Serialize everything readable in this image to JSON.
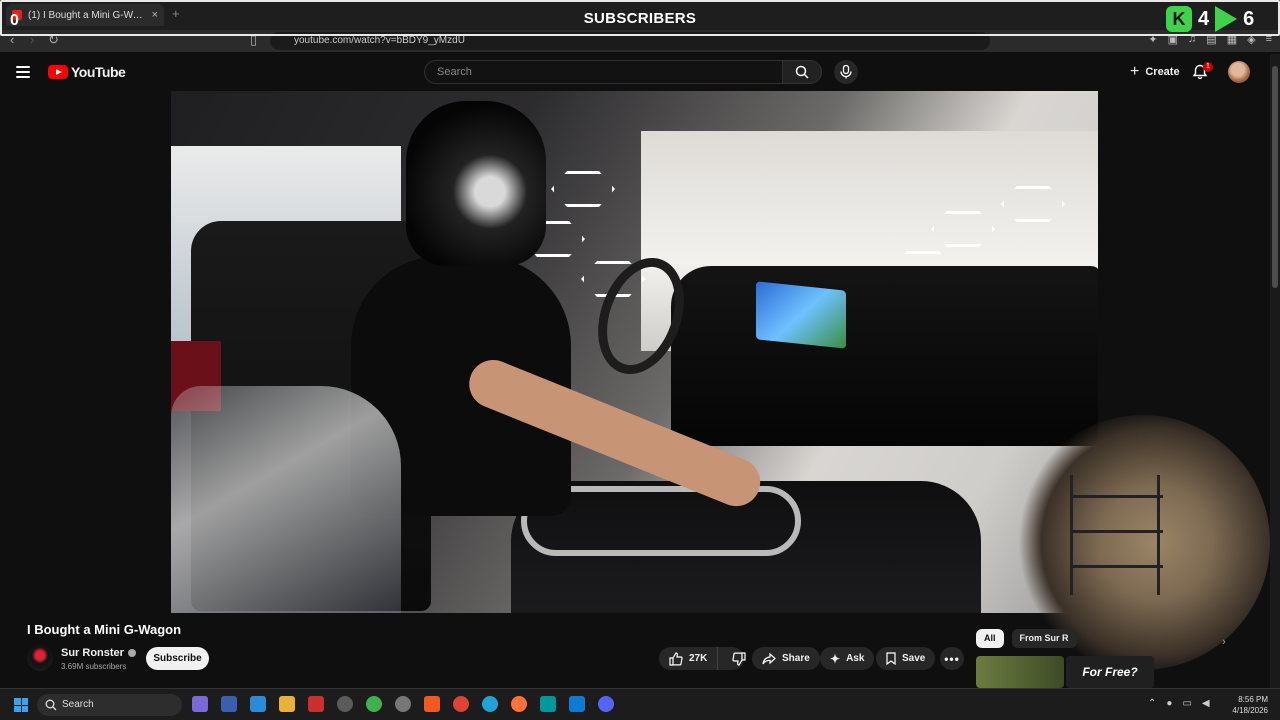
{
  "overlay": {
    "title": "SUBSCRIBERS",
    "left_count": "0",
    "right_count_a": "4",
    "right_count_b": "6"
  },
  "browser": {
    "tab_title": "(1) I Bought a Mini G-Wagon",
    "tab_close": "×",
    "new_tab": "+",
    "url": "youtube.com/watch?v=bBDY9_yMzdU"
  },
  "youtube": {
    "logo_text": "YouTube",
    "search_placeholder": "Search",
    "create_label": "Create",
    "notification_count": "1"
  },
  "video": {
    "title": "I Bought a Mini G-Wagon",
    "channel_name": "Sur Ronster",
    "subscribers": "3.69M subscribers",
    "subscribe_label": "Subscribe",
    "likes": "27K",
    "share_label": "Share",
    "ask_label": "Ask",
    "save_label": "Save"
  },
  "sidebar": {
    "chips": [
      "All",
      "From Sur R"
    ],
    "thumb_text": "For Free?"
  },
  "taskbar": {
    "search_label": "Search",
    "time": "8:56 PM",
    "date": "4/18/2026"
  },
  "colors": {
    "accent_red": "#ff0000",
    "overlay_green": "#3ed34b",
    "background": "#0f0f0f"
  }
}
